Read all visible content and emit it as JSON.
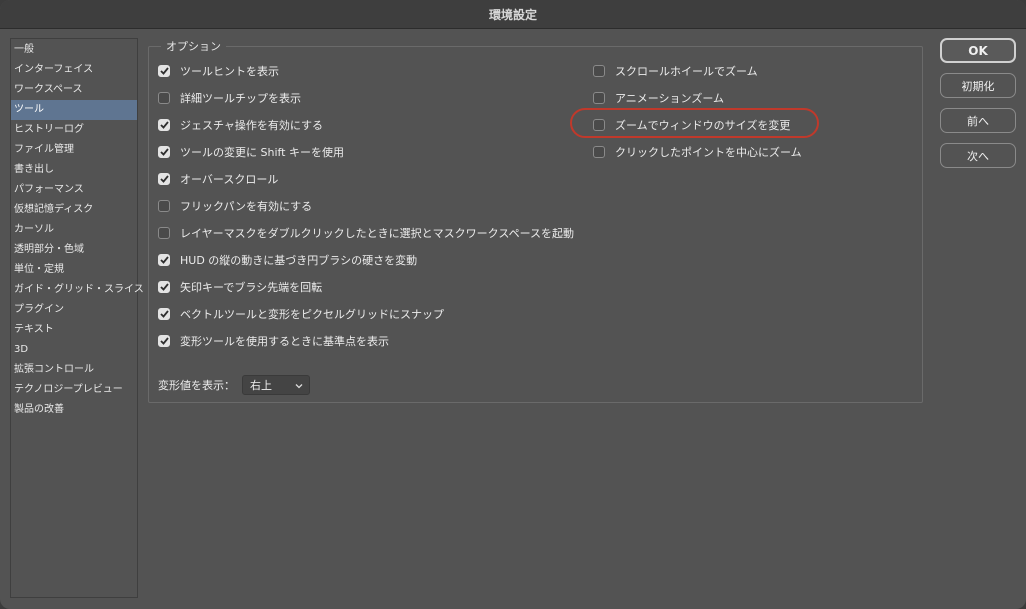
{
  "window": {
    "title": "環境設定"
  },
  "sidebar": {
    "items": [
      {
        "label": "一般"
      },
      {
        "label": "インターフェイス"
      },
      {
        "label": "ワークスペース"
      },
      {
        "label": "ツール",
        "selected": true
      },
      {
        "label": "ヒストリーログ"
      },
      {
        "label": "ファイル管理"
      },
      {
        "label": "書き出し"
      },
      {
        "label": "パフォーマンス"
      },
      {
        "label": "仮想記憶ディスク"
      },
      {
        "label": "カーソル"
      },
      {
        "label": "透明部分・色域"
      },
      {
        "label": "単位・定規"
      },
      {
        "label": "ガイド・グリッド・スライス"
      },
      {
        "label": "プラグイン"
      },
      {
        "label": "テキスト"
      },
      {
        "label": "3D"
      },
      {
        "label": "拡張コントロール"
      },
      {
        "label": "テクノロジープレビュー"
      },
      {
        "label": "製品の改善"
      }
    ]
  },
  "options": {
    "legend": "オプション",
    "left": [
      {
        "label": "ツールヒントを表示",
        "checked": true
      },
      {
        "label": "詳細ツールチップを表示",
        "checked": false
      },
      {
        "label": "ジェスチャ操作を有効にする",
        "checked": true
      },
      {
        "label": "ツールの変更に Shift キーを使用",
        "checked": true
      },
      {
        "label": "オーバースクロール",
        "checked": true
      },
      {
        "label": "フリックパンを有効にする",
        "checked": false
      },
      {
        "label": "レイヤーマスクをダブルクリックしたときに選択とマスクワークスペースを起動",
        "checked": false
      },
      {
        "label": "HUD の縦の動きに基づき円ブラシの硬さを変動",
        "checked": true
      },
      {
        "label": "矢印キーでブラシ先端を回転",
        "checked": true
      },
      {
        "label": "ベクトルツールと変形をピクセルグリッドにスナップ",
        "checked": true
      },
      {
        "label": "変形ツールを使用するときに基準点を表示",
        "checked": true
      }
    ],
    "right": [
      {
        "label": "スクロールホイールでズーム",
        "checked": false
      },
      {
        "label": "アニメーションズーム",
        "checked": false
      },
      {
        "label": "ズームでウィンドウのサイズを変更",
        "checked": false
      },
      {
        "label": "クリックしたポイントを中心にズーム",
        "checked": false
      }
    ],
    "transform_display": {
      "label": "変形値を表示：",
      "value": "右上"
    }
  },
  "buttons": {
    "ok": "OK",
    "reset": "初期化",
    "prev": "前へ",
    "next": "次へ"
  },
  "colors": {
    "highlight_ring": "#c0392b",
    "sidebar_selected": "#5f7591"
  }
}
